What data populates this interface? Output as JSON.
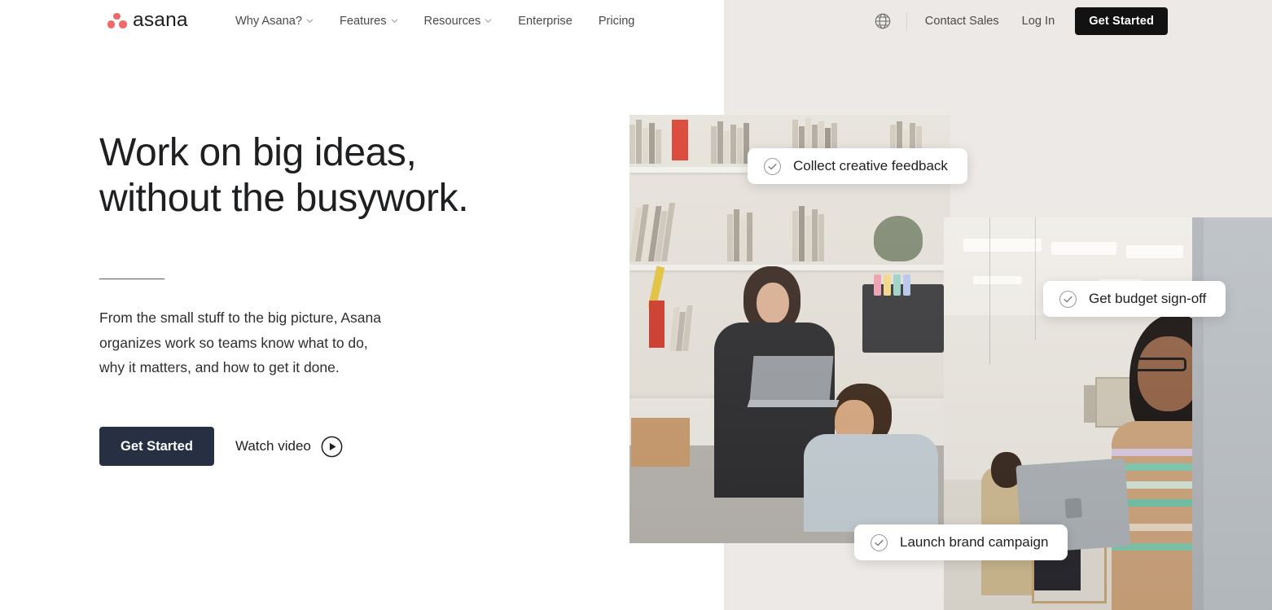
{
  "brand": {
    "name": "asana",
    "logo_dot_color": "#f06a6a",
    "wordmark_color": "#1e1f21"
  },
  "header": {
    "nav_items": [
      {
        "label": "Why Asana?",
        "has_dropdown": true,
        "icon": "chevron-down-icon"
      },
      {
        "label": "Features",
        "has_dropdown": true,
        "icon": "chevron-down-icon"
      },
      {
        "label": "Resources",
        "has_dropdown": true,
        "icon": "chevron-down-icon"
      },
      {
        "label": "Enterprise",
        "has_dropdown": false
      },
      {
        "label": "Pricing",
        "has_dropdown": false
      }
    ],
    "language_icon": "globe-icon",
    "contact_sales_label": "Contact Sales",
    "login_label": "Log In",
    "get_started_label": "Get Started",
    "get_started_bg": "#121212"
  },
  "hero": {
    "headline": "Work on big ideas,\nwithout the busywork.",
    "subcopy": "From the small stuff to the big picture, Asana\norganizes work so teams know what to do,\nwhy it matters, and how to get it done.",
    "primary_cta_label": "Get Started",
    "primary_cta_bg": "#273042",
    "secondary_cta_label": "Watch video",
    "secondary_cta_icon": "play-circle-icon"
  },
  "task_cards": [
    {
      "label": "Collect creative feedback",
      "icon": "check-circle-icon"
    },
    {
      "label": "Get budget sign-off",
      "icon": "check-circle-icon"
    },
    {
      "label": "Launch brand campaign",
      "icon": "check-circle-icon"
    }
  ],
  "media": {
    "left_photo_alt": "Two coworkers reviewing work at a studio desk with shelves of books",
    "right_photo_alt": "Woman holding a laptop in an open office with colleagues in background"
  },
  "theme": {
    "page_bg": "#ffffff",
    "panel_bg": "#ece9e7",
    "text_primary": "#1e1f21",
    "text_secondary": "#4a4a4a"
  }
}
